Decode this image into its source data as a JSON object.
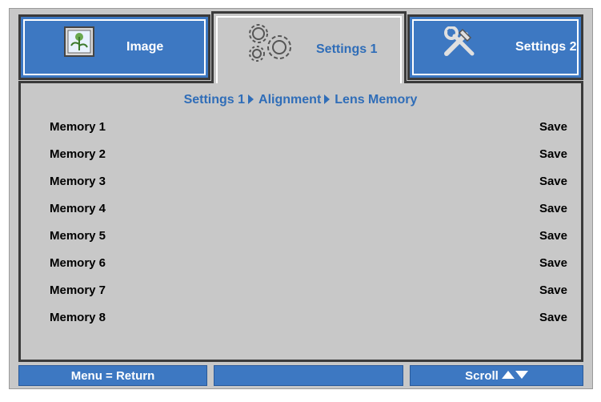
{
  "tabs": [
    {
      "label": "Image",
      "icon": "image-icon",
      "active": false
    },
    {
      "label": "Settings 1",
      "icon": "gears-icon",
      "active": true
    },
    {
      "label": "Settings 2",
      "icon": "tools-icon",
      "active": false
    }
  ],
  "breadcrumb": {
    "part1": "Settings 1",
    "part2": "Alignment",
    "part3": "Lens Memory"
  },
  "rows": [
    {
      "label": "Memory 1",
      "value": "Save"
    },
    {
      "label": "Memory 2",
      "value": "Save"
    },
    {
      "label": "Memory 3",
      "value": "Save"
    },
    {
      "label": "Memory 4",
      "value": "Save"
    },
    {
      "label": "Memory 5",
      "value": "Save"
    },
    {
      "label": "Memory 6",
      "value": "Save"
    },
    {
      "label": "Memory 7",
      "value": "Save"
    },
    {
      "label": "Memory 8",
      "value": "Save"
    }
  ],
  "footer": {
    "left": "Menu = Return",
    "middle": "",
    "right": "Scroll"
  },
  "colors": {
    "accent_blue": "#3d78c2",
    "panel_gray": "#c8c8c8",
    "text_blue": "#2f6db8"
  }
}
